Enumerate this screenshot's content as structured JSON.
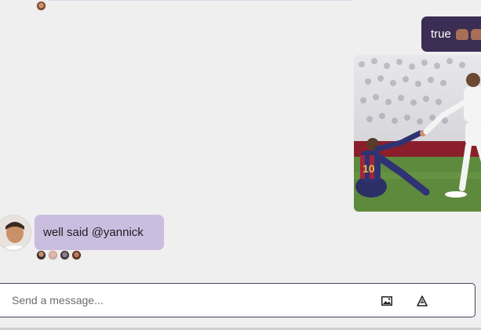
{
  "messages": {
    "sent": {
      "text": "true",
      "emoji_icon": "raised-hands-emoji",
      "bubble_color": "#3b2d53"
    },
    "received": {
      "text": "well said @yannick",
      "bubble_color": "#cbbde0"
    }
  },
  "composer": {
    "placeholder": "Send a message...",
    "image_icon": "image-icon",
    "format_icon": "format-icon"
  },
  "colors": {
    "background": "#efefef",
    "accent": "#3b2d53",
    "received_bubble": "#cbbde0"
  }
}
